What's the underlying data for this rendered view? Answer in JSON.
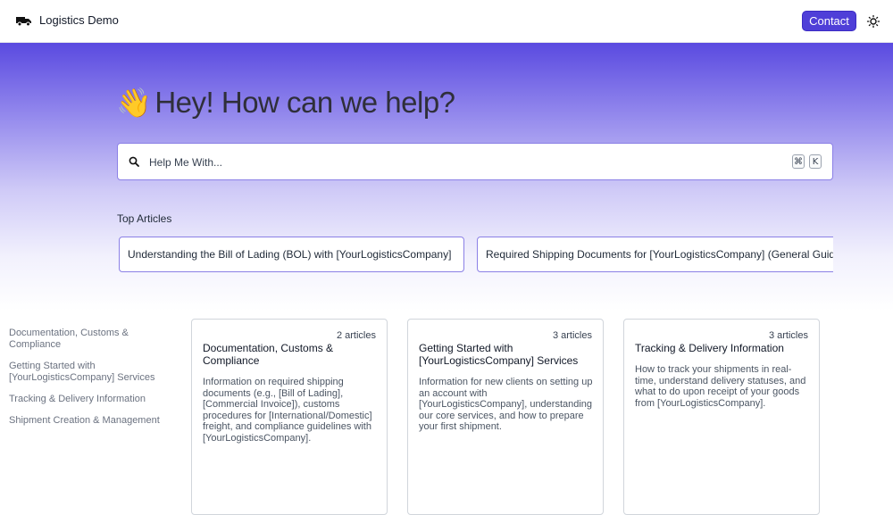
{
  "header": {
    "brand": "Logistics Demo",
    "contact_label": "Contact",
    "logo_icon": "truck-icon",
    "theme_icon": "sun-icon",
    "accent": "#4f3fd8"
  },
  "hero": {
    "emoji": "👋",
    "title": "Hey! How can we help?",
    "search": {
      "placeholder": "Help Me With...",
      "value": "",
      "shortcut_mod": "⌘",
      "shortcut_key": "K"
    }
  },
  "top_articles": {
    "label": "Top Articles",
    "items": [
      "Understanding the Bill of Lading (BOL) with [YourLogisticsCompany]",
      "Required Shipping Documents for [YourLogisticsCompany] (General Guide)"
    ]
  },
  "sidebar": {
    "items": [
      "Documentation, Customs & Compliance",
      "Getting Started with [YourLogisticsCompany] Services",
      "Tracking & Delivery Information",
      "Shipment Creation & Management"
    ]
  },
  "categories": [
    {
      "count": "2 articles",
      "title": "Documentation, Customs & Compliance",
      "description": "Information on required shipping documents (e.g., [Bill of Lading], [Commercial Invoice]), customs procedures for [International/Domestic] freight, and compliance guidelines with [YourLogisticsCompany]."
    },
    {
      "count": "3 articles",
      "title": "Getting Started with [YourLogisticsCompany] Services",
      "description": "Information for new clients on setting up an account with [YourLogisticsCompany], understanding our core services, and how to prepare your first shipment."
    },
    {
      "count": "3 articles",
      "title": "Tracking & Delivery Information",
      "description": "How to track your shipments in real-time, understand delivery statuses, and what to do upon receipt of your goods from [YourLogisticsCompany]."
    }
  ]
}
